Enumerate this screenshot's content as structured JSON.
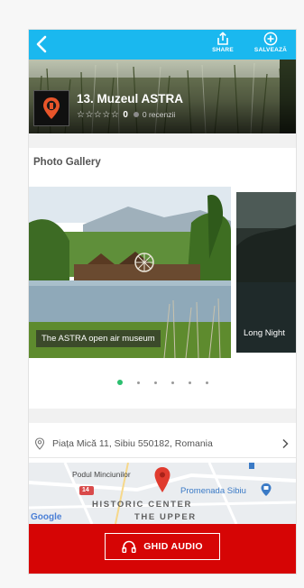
{
  "colors": {
    "topbar": "#1ab8ef",
    "footer": "#d60505",
    "active_dot": "#2cbf6f"
  },
  "topbar": {
    "back_icon": "chevron-left-icon",
    "share": {
      "icon": "share-icon",
      "label": "SHARE"
    },
    "save": {
      "icon": "plus-circle-icon",
      "label": "SALVEAZĂ"
    }
  },
  "place": {
    "title": "13. Muzeul ASTRA",
    "stars": "☆☆☆☆☆",
    "rating": "0",
    "reviews": "0 recenzii"
  },
  "gallery": {
    "title": "Photo Gallery",
    "slides": [
      {
        "caption": "The ASTRA open air museum"
      },
      {
        "caption": "Long Night"
      }
    ],
    "dots_total": 6,
    "active_dot": 1
  },
  "address": {
    "icon": "map-pin-icon",
    "text": "Piața Mică 11, Sibiu 550182, Romania"
  },
  "map": {
    "labels": {
      "bridge": "Podul Minciunilor",
      "promenade": "Promenada Sibiu",
      "center": "HISTORIC CENTER",
      "upper": "THE UPPER",
      "route": "14",
      "google": "Google"
    }
  },
  "footer": {
    "button_label": "GHID AUDIO",
    "icon": "headphones-icon"
  }
}
